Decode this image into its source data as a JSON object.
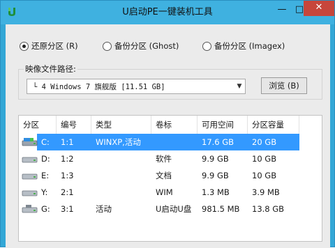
{
  "window": {
    "title": "U启动PE一键装机工具",
    "minimize_glyph": "—",
    "maximize_glyph": "□",
    "close_glyph": "✕"
  },
  "mode_options": [
    {
      "label": "还原分区 (R)",
      "checked": true
    },
    {
      "label": "备份分区 (Ghost)",
      "checked": false
    },
    {
      "label": "备份分区 (Imagex)",
      "checked": false
    }
  ],
  "image_path": {
    "label": "映像文件路径:",
    "selected_value": "└ 4 Windows 7 旗舰版 [11.51 GB]",
    "browse_label": "浏览 (B)"
  },
  "table": {
    "columns": [
      "分区",
      "编号",
      "类型",
      "卷标",
      "可用空间",
      "分区容量"
    ],
    "rows": [
      {
        "drive": "C:",
        "number": "1:1",
        "type": "WINXP,活动",
        "label": "",
        "free": "17.6 GB",
        "capacity": "20 GB",
        "selected": true
      },
      {
        "drive": "D:",
        "number": "1:2",
        "type": "",
        "label": "软件",
        "free": "9.9 GB",
        "capacity": "10 GB",
        "selected": false
      },
      {
        "drive": "E:",
        "number": "1:3",
        "type": "",
        "label": "文档",
        "free": "9.9 GB",
        "capacity": "10 GB",
        "selected": false
      },
      {
        "drive": "Y:",
        "number": "2:1",
        "type": "",
        "label": "WIM",
        "free": "1.3 MB",
        "capacity": "3.9 MB",
        "selected": false
      },
      {
        "drive": "G:",
        "number": "3:1",
        "type": "活动",
        "label": "U启动U盘",
        "free": "981.5 MB",
        "capacity": "13.8 GB",
        "selected": false
      }
    ]
  },
  "colors": {
    "titlebar": "#3fb1e0",
    "close_button": "#c7463b",
    "selection": "#3399ff"
  }
}
